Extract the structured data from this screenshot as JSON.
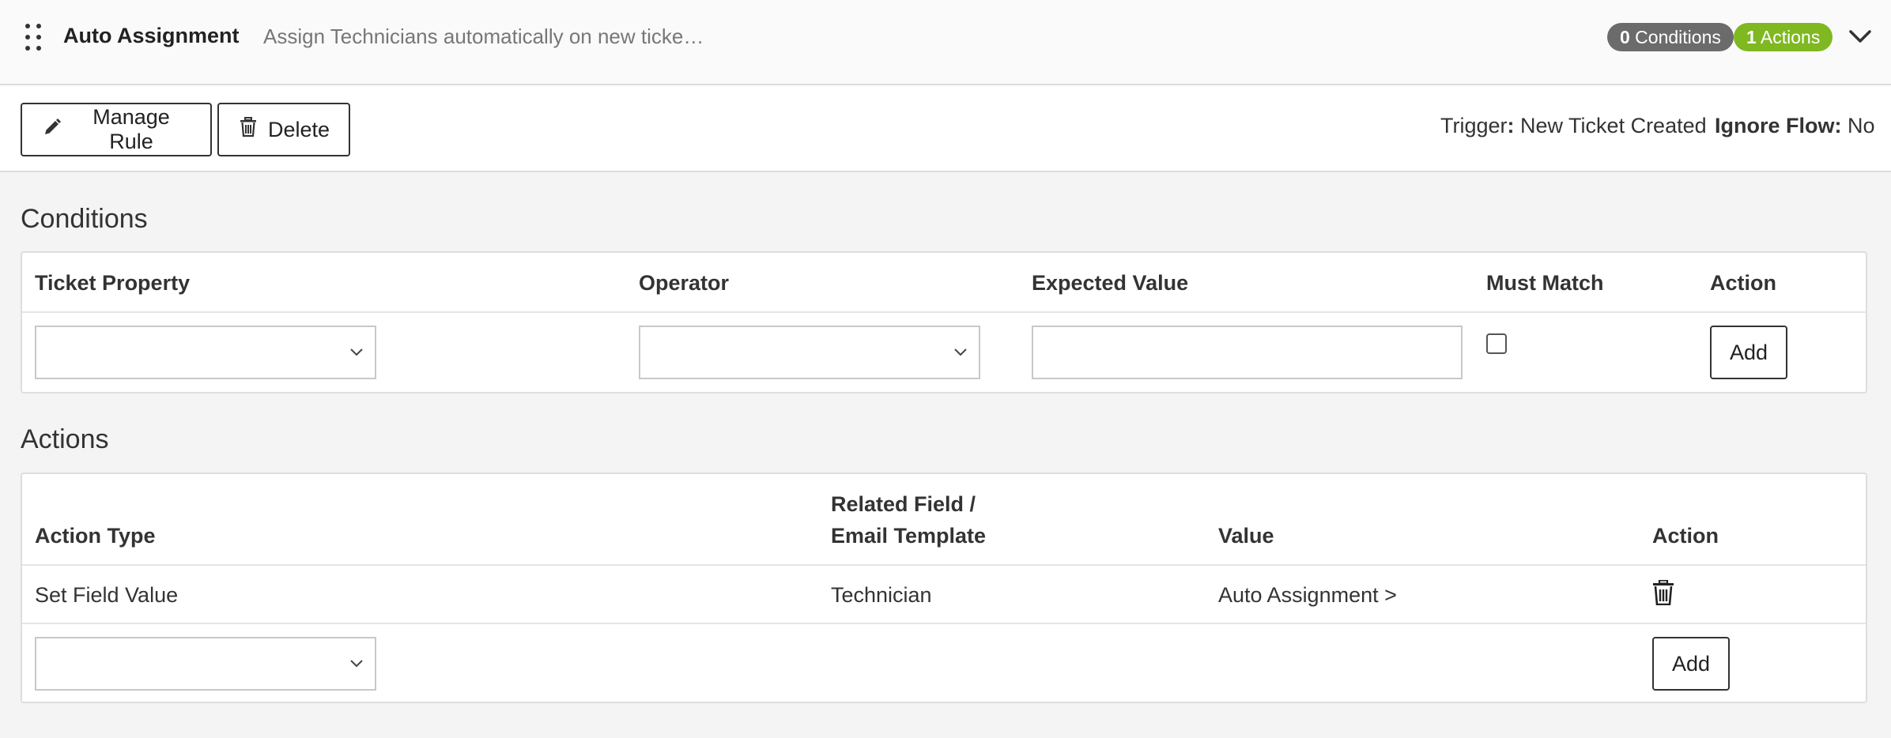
{
  "header": {
    "rule_name": "Auto Assignment",
    "rule_description": "Assign Technicians automatically on new ticke…",
    "conditions_count": "0",
    "conditions_label": " Conditions",
    "actions_count": "1",
    "actions_label": " Actions",
    "icons": {
      "drag": "drag-handle-icon",
      "expand": "chevron-down-icon"
    },
    "colors": {
      "conditions_badge": "#6b6b6b",
      "actions_badge": "#7fb820"
    }
  },
  "toolbar": {
    "manage_label": "Manage Rule",
    "delete_label": "Delete",
    "trigger_label": "Trigger",
    "trigger_colon": ":",
    "trigger_value": " New Ticket Created",
    "ignore_flow_label": "Ignore Flow:",
    "ignore_flow_value": " No",
    "icons": {
      "manage": "pencil-icon",
      "delete": "trash-icon"
    }
  },
  "conditions": {
    "title": "Conditions",
    "columns": [
      "Ticket Property",
      "Operator",
      "Expected Value",
      "Must Match",
      "Action"
    ],
    "new_row": {
      "ticket_property": "",
      "operator": "",
      "expected_value": "",
      "must_match": false,
      "add_label": "Add"
    }
  },
  "actions": {
    "title": "Actions",
    "columns": {
      "action_type": "Action Type",
      "related_field_line1": "Related Field /",
      "related_field_line2": "Email Template",
      "value": "Value",
      "action": "Action"
    },
    "rows": [
      {
        "action_type": "Set Field Value",
        "related_field": "Technician",
        "value": "Auto Assignment >"
      }
    ],
    "new_row": {
      "action_type": "",
      "add_label": "Add"
    }
  }
}
